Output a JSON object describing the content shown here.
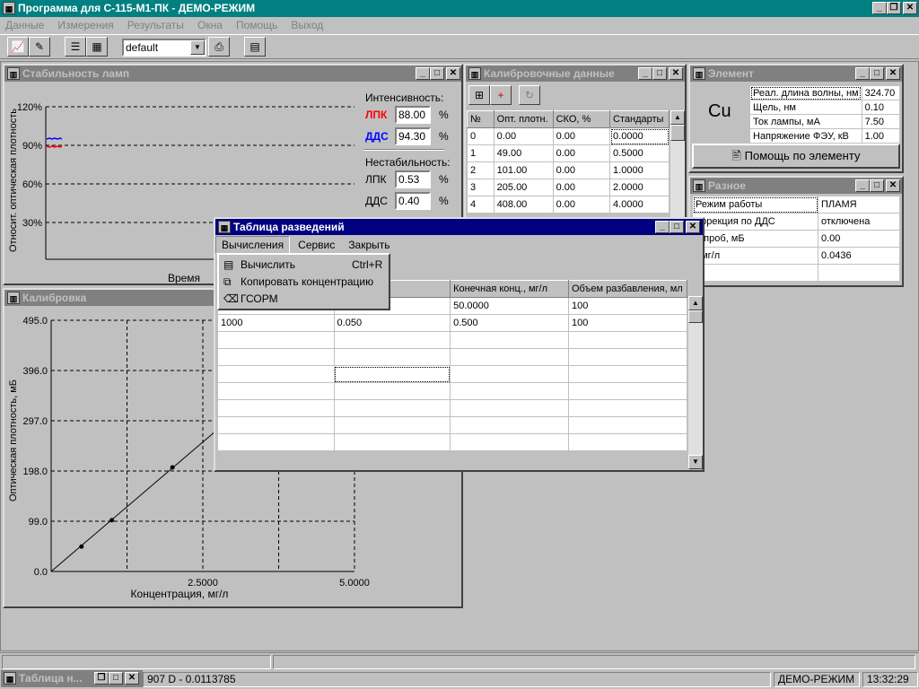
{
  "app": {
    "title": "Программа для С-115-М1-ПК - ДЕМО-РЕЖИМ",
    "menu": [
      "Данные",
      "Измерения",
      "Результаты",
      "Окна",
      "Помощь",
      "Выход"
    ],
    "method_select": "default"
  },
  "stability": {
    "title": "Стабильность ламп",
    "ylabel": "Относит. оптическая плотность",
    "xlabel": "Время",
    "yticks": [
      "120%",
      "90%",
      "60%",
      "30%"
    ],
    "intensity_label": "Интенсивность:",
    "lpk_label": "ЛПК",
    "lpk_value": "88.00",
    "dds_label": "ДДС",
    "dds_value": "94.30",
    "instability_label": "Нестабильность:",
    "inst_lpk_label": "ЛПК",
    "inst_lpk_value": "0.53",
    "inst_dds_label": "ДДС",
    "inst_dds_value": "0.40",
    "unit": "%",
    "colors": {
      "lpk": "#ff0000",
      "dds": "#0000ff"
    }
  },
  "calib_data": {
    "title": "Калибровочные данные",
    "headers": [
      "№",
      "Опт. плотн.",
      "СКО, %",
      "Стандарты"
    ],
    "rows": [
      [
        "0",
        "0.00",
        "0.00",
        "0.0000"
      ],
      [
        "1",
        "49.00",
        "0.00",
        "0.5000"
      ],
      [
        "2",
        "101.00",
        "0.00",
        "1.0000"
      ],
      [
        "3",
        "205.00",
        "0.00",
        "2.0000"
      ],
      [
        "4",
        "408.00",
        "0.00",
        "4.0000"
      ]
    ]
  },
  "element": {
    "title": "Элемент",
    "symbol": "Cu",
    "params": [
      [
        "Реал. длина волны, нм",
        "324.70"
      ],
      [
        "Щель, нм",
        "0.10"
      ],
      [
        "Ток лампы, мА",
        "7.50"
      ],
      [
        "Напряжение ФЭУ, кВ",
        "1.00"
      ]
    ],
    "help_button": "Помощь по элементу"
  },
  "misc": {
    "title": "Разное",
    "rows": [
      [
        "Режим работы",
        "ПЛАМЯ"
      ],
      [
        "оррекция по ДДС",
        "отключена"
      ],
      [
        "о проб, мБ",
        "0.00"
      ],
      [
        ", мг/л",
        "0.0436"
      ],
      [
        "",
        ""
      ]
    ]
  },
  "calibration": {
    "title": "Калибровка",
    "ylabel": "Оптическая плотность, мБ",
    "xlabel": "Концентрация, мг/л",
    "yticks": [
      "495.0",
      "396.0",
      "297.0",
      "198.0",
      "99.0",
      "0.0"
    ],
    "xticks": [
      "2.5000",
      "5.0000"
    ]
  },
  "chart_data": {
    "type": "scatter",
    "title": "Калибровка",
    "xlabel": "Концентрация, мг/л",
    "ylabel": "Оптическая плотность, мБ",
    "xlim": [
      0,
      5.0
    ],
    "ylim": [
      0,
      495
    ],
    "points": [
      {
        "x": 0.5,
        "y": 49
      },
      {
        "x": 1.0,
        "y": 101
      },
      {
        "x": 2.0,
        "y": 205
      }
    ],
    "line": {
      "x0": 0,
      "y0": 0,
      "x1": 4.0,
      "y1": 408
    },
    "grid": true
  },
  "dilution": {
    "title": "Таблица разведений",
    "menu": [
      "Вычисления",
      "Сервис",
      "Закрыть"
    ],
    "dropdown": [
      {
        "label": "Вычислить",
        "shortcut": "Ctrl+R",
        "icon": "calculator-icon"
      },
      {
        "label": "Копировать концентрацию",
        "shortcut": "",
        "icon": "copy-icon"
      },
      {
        "label": "ГСОРМ",
        "shortcut": "",
        "icon": "eraser-icon"
      }
    ],
    "headers": [
      "",
      "ил",
      "Конечная конц., мг/л",
      "Объем разбавления, мл"
    ],
    "rows": [
      [
        "",
        "",
        "50.0000",
        "100"
      ],
      [
        "1000",
        "0.050",
        "0.500",
        "100"
      ],
      [
        "",
        "",
        "",
        ""
      ],
      [
        "",
        "",
        "",
        ""
      ],
      [
        "",
        "",
        "",
        ""
      ],
      [
        "",
        "",
        "",
        ""
      ],
      [
        "",
        "",
        "",
        ""
      ],
      [
        "",
        "",
        "",
        ""
      ],
      [
        "",
        "",
        "",
        ""
      ]
    ]
  },
  "minimized": {
    "title": "Таблица н..."
  },
  "status": {
    "left": "907 D - 0.0113785",
    "mode": "ДЕМО-РЕЖИМ",
    "time": "13:32:29"
  }
}
